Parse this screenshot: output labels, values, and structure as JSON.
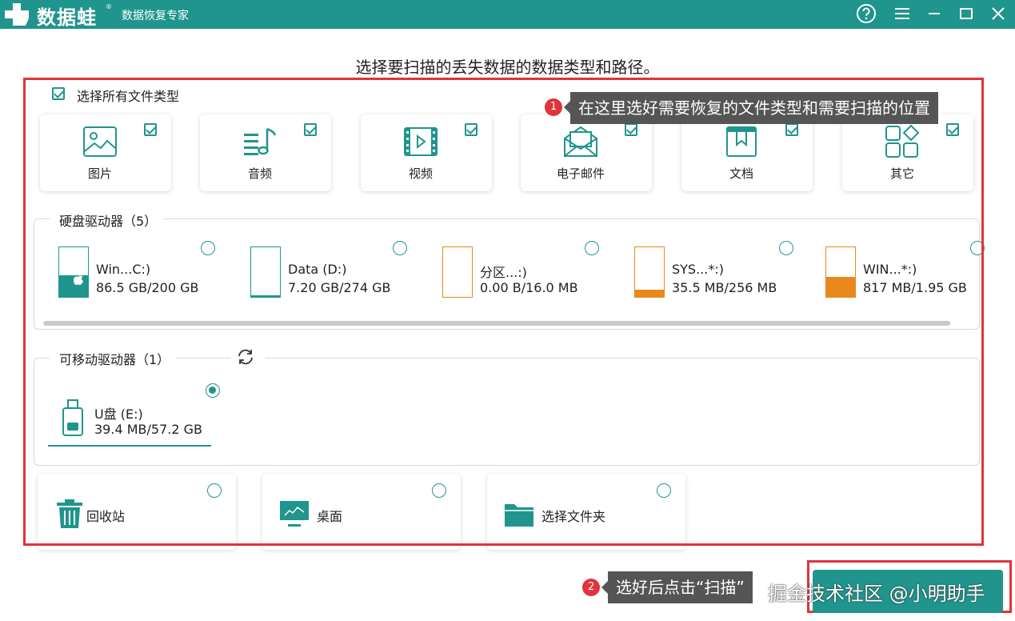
{
  "app": {
    "logo_text": "数据蛙",
    "registered_mark": "®",
    "subtitle": "数据恢复专家"
  },
  "headline": "选择要扫描的丢失数据的数据类型和路径。",
  "select_all": {
    "label": "选择所有文件类型",
    "checked": true
  },
  "file_types": [
    {
      "label": "图片",
      "icon": "image-icon",
      "checked": true
    },
    {
      "label": "音频",
      "icon": "music-icon",
      "checked": true
    },
    {
      "label": "视频",
      "icon": "video-icon",
      "checked": true
    },
    {
      "label": "电子邮件",
      "icon": "mail-icon",
      "checked": true
    },
    {
      "label": "文档",
      "icon": "document-icon",
      "checked": true
    },
    {
      "label": "其它",
      "icon": "other-icon",
      "checked": true
    }
  ],
  "callout1": {
    "number": "1",
    "text": "在这里选好需要恢复的文件类型和需要扫描的位置"
  },
  "hard_drives": {
    "title": "硬盘驱动器（5）",
    "items": [
      {
        "name": "Win...C:)",
        "size": "86.5 GB/200 GB",
        "used_fraction": 0.43,
        "color": "#1f958e"
      },
      {
        "name": "Data (D:)",
        "size": "7.20 GB/274 GB",
        "used_fraction": 0.03,
        "color": "#1f958e"
      },
      {
        "name": "分区...:)",
        "size": "0.00  B/16.0 MB",
        "used_fraction": 0.0,
        "color": "#e8891d"
      },
      {
        "name": "SYS...*:)",
        "size": "35.5 MB/256 MB",
        "used_fraction": 0.14,
        "color": "#e8891d"
      },
      {
        "name": "WIN...*:)",
        "size": "817 MB/1.95 GB",
        "used_fraction": 0.41,
        "color": "#e8891d"
      }
    ]
  },
  "removable": {
    "title": "可移动驱动器（1）",
    "items": [
      {
        "name": "U盘 (E:)",
        "size": "39.4 MB/57.2 GB",
        "selected": true
      }
    ]
  },
  "locations": [
    {
      "label": "回收站",
      "icon": "recycle-bin-icon"
    },
    {
      "label": "桌面",
      "icon": "desktop-icon"
    },
    {
      "label": "选择文件夹",
      "icon": "folder-icon"
    }
  ],
  "callout2": {
    "number": "2",
    "text": "选好后点击“扫描”"
  },
  "watermark": "掘金技术社区 @小明助手",
  "colors": {
    "accent": "#1f958e",
    "orange": "#e8891d",
    "highlight_red": "#e0333b"
  }
}
